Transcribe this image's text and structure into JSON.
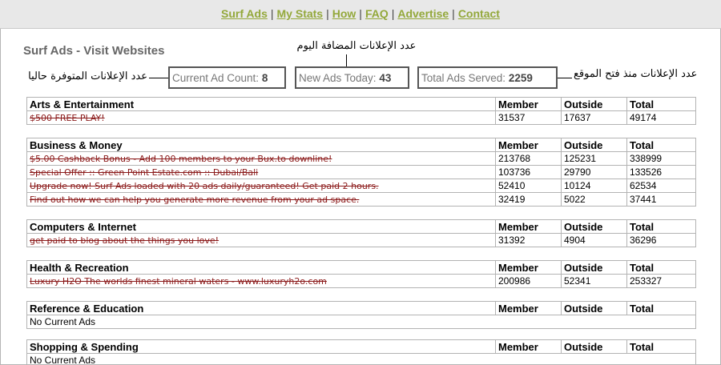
{
  "nav": [
    "Surf Ads",
    "My Stats",
    "How",
    "FAQ",
    "Advertise",
    "Contact"
  ],
  "nav_separator": "|",
  "page_title": "Surf Ads - Visit Websites",
  "stats": {
    "current": {
      "label": "Current Ad Count:",
      "value": "8"
    },
    "today": {
      "label": "New Ads Today:",
      "value": "43"
    },
    "total": {
      "label": "Total Ads Served:",
      "value": "2259"
    }
  },
  "annotations": {
    "current": "عدد الإعلانات المتوفرة حاليا",
    "today": "عدد الإعلانات المضافة اليوم",
    "total": "عدد الإعلانات منذ فتح الموقع"
  },
  "columns": {
    "member": "Member",
    "outside": "Outside",
    "total": "Total"
  },
  "categories": [
    {
      "name": "Arts & Entertainment",
      "ads": [
        {
          "title": "$500 FREE PLAY!",
          "member": "31537",
          "outside": "17637",
          "total": "49174"
        }
      ]
    },
    {
      "name": "Business & Money",
      "ads": [
        {
          "title": "$5.00 Cashback Bonus - Add 100 members to your Bux.to downline!",
          "member": "213768",
          "outside": "125231",
          "total": "338999"
        },
        {
          "title": "Special Offer :: Green Point Estate.com :: Dubai/Bali",
          "member": "103736",
          "outside": "29790",
          "total": "133526"
        },
        {
          "title": "Upgrade now! Surf Ads loaded with 20 ads daily/guaranteed! Get paid 2 hours.",
          "member": "52410",
          "outside": "10124",
          "total": "62534"
        },
        {
          "title": "Find out how we can help you generate more revenue from your ad space.",
          "member": "32419",
          "outside": "5022",
          "total": "37441"
        }
      ]
    },
    {
      "name": "Computers & Internet",
      "ads": [
        {
          "title": "get paid to blog about the things you love!",
          "member": "31392",
          "outside": "4904",
          "total": "36296"
        }
      ]
    },
    {
      "name": "Health & Recreation",
      "ads": [
        {
          "title": "Luxury H2O  The worlds finest mineral waters - www.luxuryh2o.com",
          "member": "200986",
          "outside": "52341",
          "total": "253327"
        }
      ]
    },
    {
      "name": "Reference & Education",
      "ads": [],
      "empty_text": "No Current Ads"
    },
    {
      "name": "Shopping & Spending",
      "ads": [],
      "empty_text": "No Current Ads"
    }
  ]
}
